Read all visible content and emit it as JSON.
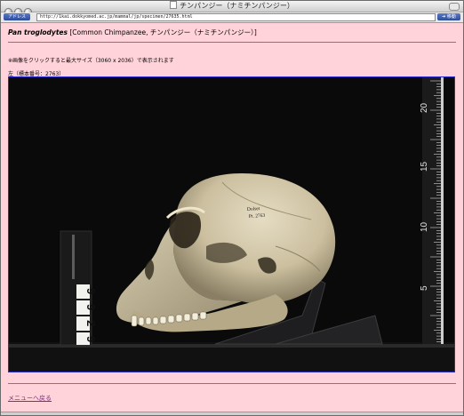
{
  "window": {
    "title": "チンパンジー（ナミチンパンジー）"
  },
  "toolbar": {
    "address_label": "アドレス",
    "url": "http://1kai.dokkyomed.ac.jp/mammal/jp/specimen/27635.html",
    "go_label": "移動"
  },
  "page": {
    "scientific_name": "Pan troglodytes",
    "common_names": "[Common Chimpanzee, チンパンジー（ナミチンパンジー）]",
    "click_note": "※画像をクリックすると最大サイズ（3060 x 2036）で表示されます",
    "view_caption": "左（標本番号：2763）",
    "menu_link": "メニューへ戻る"
  },
  "specimen": {
    "skull_label_line1": "Dolset",
    "skull_label_line2": "Pt. 2763",
    "tag_digits": [
      "9",
      "9",
      "2",
      "9"
    ],
    "ruler_labels": [
      "20",
      "15",
      "10",
      "5"
    ]
  }
}
